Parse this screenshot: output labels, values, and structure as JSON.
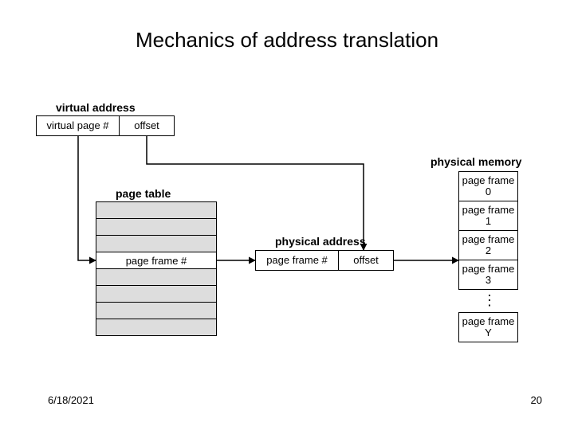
{
  "title": "Mechanics of address translation",
  "labels": {
    "virtual_address": "virtual address",
    "physical_memory": "physical memory",
    "page_table": "page table",
    "physical_address": "physical address"
  },
  "virtual_address_box": {
    "left": "virtual page #",
    "right": "offset"
  },
  "page_table_entry": "page frame #",
  "physical_address_box": {
    "left": "page frame #",
    "right": "offset"
  },
  "physical_memory_frames": [
    "page frame 0",
    "page frame 1",
    "page frame 2",
    "page frame 3"
  ],
  "physical_memory_last": "page frame Y",
  "ellipsis": "…",
  "footer": {
    "date": "6/18/2021",
    "page": "20"
  }
}
